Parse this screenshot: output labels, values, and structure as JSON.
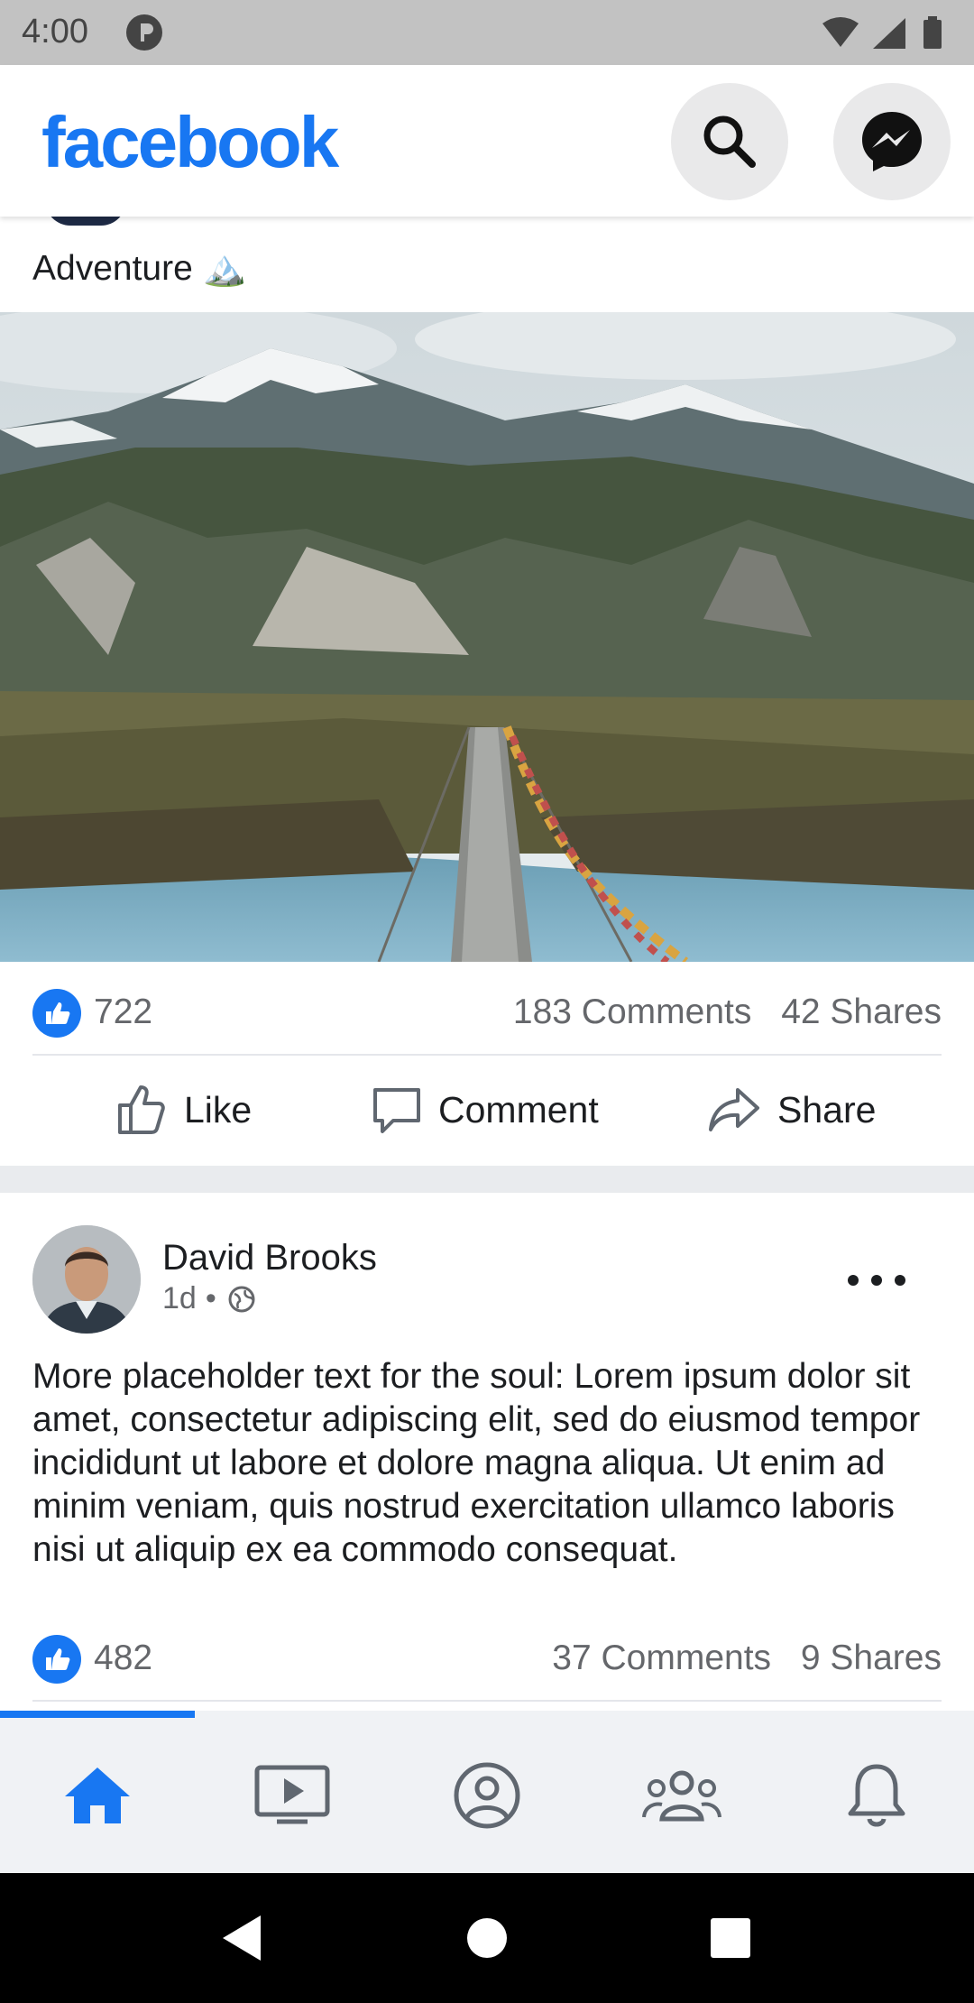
{
  "status_bar": {
    "time": "4:00"
  },
  "header": {
    "logo": "facebook",
    "search_icon": "search-icon",
    "messenger_icon": "messenger-icon"
  },
  "post1": {
    "caption": "Adventure 🏔️",
    "image": "mountain-bridge-photo",
    "likes": "722",
    "comments": "183 Comments",
    "shares": "42 Shares",
    "actions": {
      "like": "Like",
      "comment": "Comment",
      "share": "Share"
    }
  },
  "post2": {
    "author": "David Brooks",
    "time": "1d",
    "separator": "•",
    "body": "More placeholder text for the soul: Lorem ipsum dolor sit amet, consectetur adipiscing elit, sed do eiusmod tempor incididunt ut labore et dolore magna aliqua. Ut enim ad minim veniam, quis nostrud exercitation ullamco laboris nisi ut aliquip ex ea commodo consequat.",
    "likes": "482",
    "comments": "37 Comments",
    "shares": "9 Shares"
  },
  "bottom_nav": {
    "items": [
      {
        "icon": "home-icon",
        "active": true
      },
      {
        "icon": "video-icon",
        "active": false
      },
      {
        "icon": "profile-icon",
        "active": false
      },
      {
        "icon": "groups-icon",
        "active": false
      },
      {
        "icon": "bell-icon",
        "active": false
      }
    ]
  },
  "colors": {
    "brand": "#1877f2",
    "secondary_text": "#65676b",
    "nav_background": "#f0f2f5"
  }
}
